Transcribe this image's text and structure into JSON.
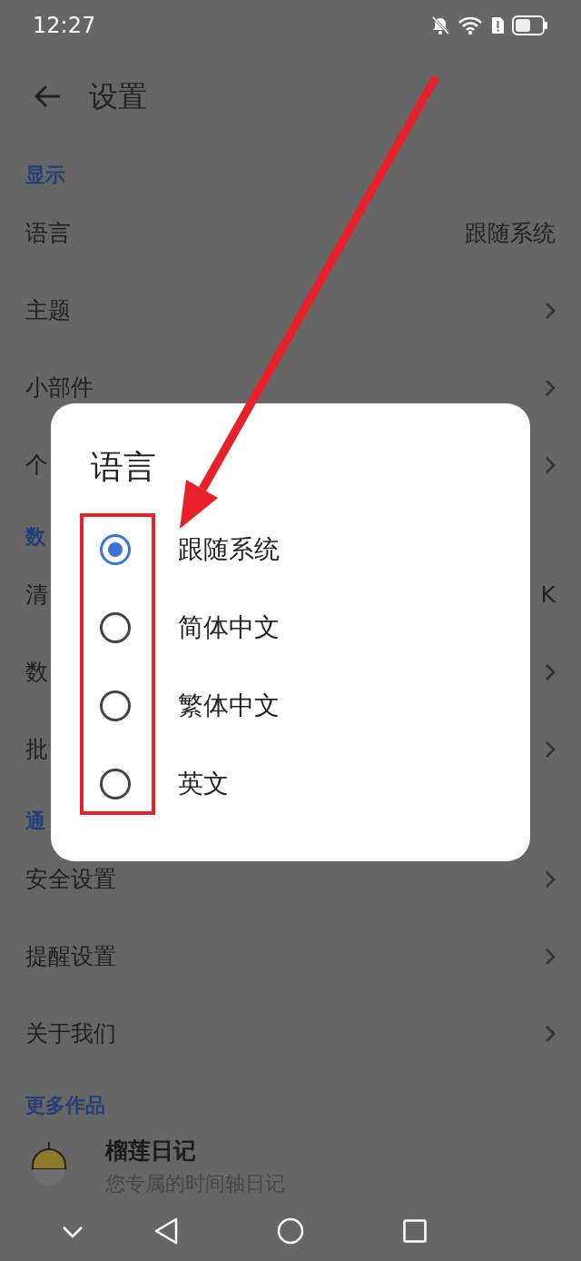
{
  "status_bar": {
    "time": "12:27"
  },
  "app_bar": {
    "title": "设置"
  },
  "sections": [
    {
      "header": "显示",
      "items": [
        {
          "label": "语言",
          "kind": "value",
          "value": "跟随系统"
        },
        {
          "label": "主题",
          "kind": "link"
        },
        {
          "label": "小部件",
          "kind": "link"
        },
        {
          "label": "个",
          "kind": "link"
        }
      ]
    },
    {
      "header": "数",
      "items": [
        {
          "label": "清",
          "kind": "value",
          "value": "K"
        },
        {
          "label": "数",
          "kind": "link"
        },
        {
          "label": "批",
          "kind": "link"
        }
      ]
    },
    {
      "header": "通",
      "items": [
        {
          "label": "安全设置",
          "kind": "link"
        },
        {
          "label": "提醒设置",
          "kind": "link"
        },
        {
          "label": "关于我们",
          "kind": "link"
        }
      ]
    },
    {
      "header": "更多作品",
      "apps": [
        {
          "title": "榴莲日记",
          "subtitle": "您专属的时间轴日记"
        }
      ]
    }
  ],
  "dialog": {
    "title": "语言",
    "options": [
      {
        "label": "跟随系统",
        "selected": true
      },
      {
        "label": "简体中文",
        "selected": false
      },
      {
        "label": "繁体中文",
        "selected": false
      },
      {
        "label": "英文",
        "selected": false
      }
    ]
  }
}
